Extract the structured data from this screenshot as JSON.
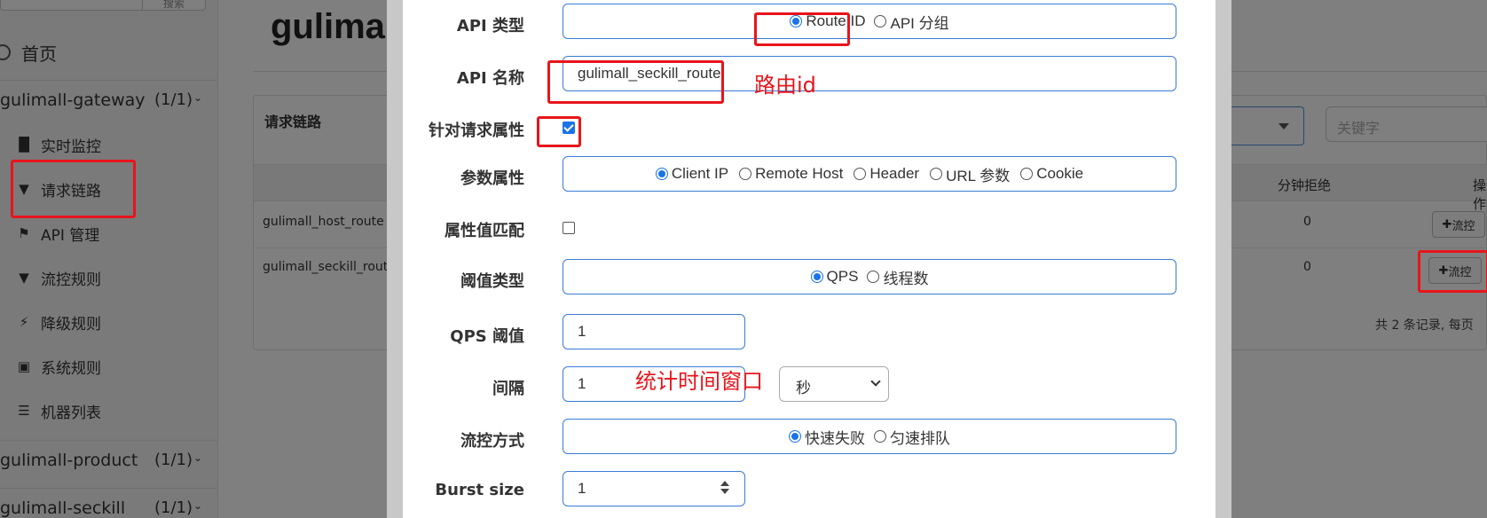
{
  "sidebar": {
    "search_button": "搜索",
    "home_label": "首页",
    "apps": [
      {
        "name": "gulimall-gateway",
        "count": "(1/1)"
      },
      {
        "name": "gulimall-product",
        "count": "(1/1)"
      },
      {
        "name": "gulimall-seckill",
        "count": "(1/1)"
      }
    ],
    "items": [
      {
        "label": "实时监控",
        "icon": "bar-chart-icon"
      },
      {
        "label": "请求链路",
        "icon": "filter-icon"
      },
      {
        "label": "API 管理",
        "icon": "tags-icon"
      },
      {
        "label": "流控规则",
        "icon": "filter-icon"
      },
      {
        "label": "降级规则",
        "icon": "bolt-icon"
      },
      {
        "label": "系统规则",
        "icon": "lock-icon"
      },
      {
        "label": "机器列表",
        "icon": "list-icon"
      }
    ]
  },
  "main": {
    "title": "gulimall-gateway",
    "panel_label": "请求链路",
    "search_placeholder": "关键字",
    "columns": {
      "reject_per_min": "分钟拒绝",
      "op": "操作"
    },
    "rows": [
      {
        "resource": "gulimall_host_route",
        "reject": "0",
        "action": "流控"
      },
      {
        "resource": "gulimall_seckill_route",
        "reject": "0",
        "action": "流控"
      }
    ],
    "pager": "共 2 条记录, 每页"
  },
  "modal": {
    "api_type": {
      "label": "API 类型",
      "options": [
        "Route ID",
        "API 分组"
      ],
      "selected": "Route ID"
    },
    "api_name": {
      "label": "API 名称",
      "value": "gulimall_seckill_route"
    },
    "req_attr": {
      "label": "针对请求属性",
      "checked": true
    },
    "param_attr": {
      "label": "参数属性",
      "options": [
        "Client IP",
        "Remote Host",
        "Header",
        "URL 参数",
        "Cookie"
      ],
      "selected": "Client IP"
    },
    "attr_match": {
      "label": "属性值匹配",
      "checked": false
    },
    "threshold_type": {
      "label": "阈值类型",
      "options": [
        "QPS",
        "线程数"
      ],
      "selected": "QPS"
    },
    "qps_threshold": {
      "label": "QPS 阈值",
      "value": "1"
    },
    "interval": {
      "label": "间隔",
      "value": "1",
      "unit": "秒"
    },
    "control_mode": {
      "label": "流控方式",
      "options": [
        "快速失败",
        "匀速排队"
      ],
      "selected": "快速失败"
    },
    "burst": {
      "label": "Burst size",
      "value": "1"
    }
  },
  "annotations": {
    "route_id_note": "路由id",
    "window_note": "统计时间窗口",
    "color": "#e8141b"
  }
}
